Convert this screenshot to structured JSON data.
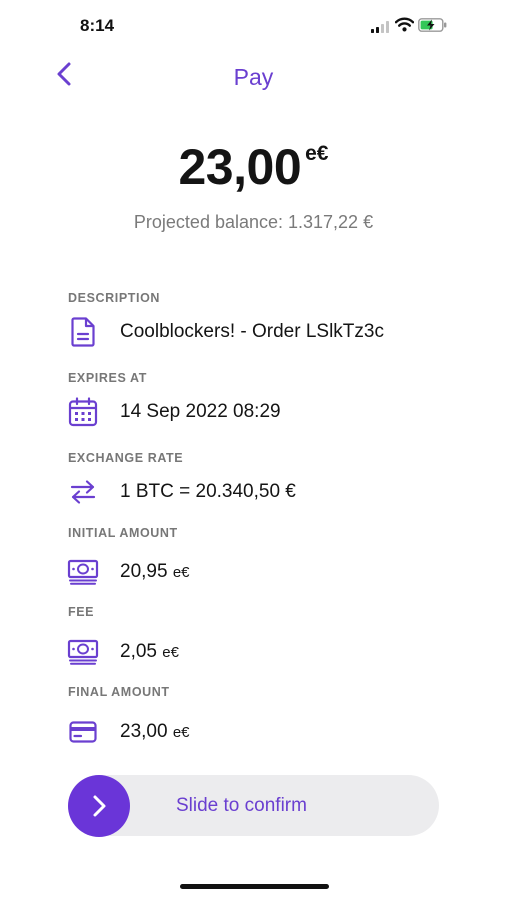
{
  "status_bar": {
    "time": "8:14",
    "icons": [
      "signal-icon",
      "wifi-icon",
      "battery-charging-icon"
    ]
  },
  "header": {
    "title": "Pay",
    "back_icon": "chevron-left-icon"
  },
  "amount": {
    "value": "23,00",
    "unit": "e€",
    "projected_balance": "Projected balance: 1.317,22 €"
  },
  "details": {
    "description": {
      "label": "DESCRIPTION",
      "value": "Coolblockers! - Order LSlkTz3c",
      "icon": "document-icon"
    },
    "expires_at": {
      "label": "EXPIRES AT",
      "value": "14 Sep 2022 08:29",
      "icon": "calendar-icon"
    },
    "exchange_rate": {
      "label": "EXCHANGE RATE",
      "value": "1 BTC = 20.340,50 €",
      "icon": "swap-arrows-icon"
    },
    "initial_amount": {
      "label": "INITIAL AMOUNT",
      "value": "20,95",
      "unit": "e€",
      "icon": "banknote-icon"
    },
    "fee": {
      "label": "FEE",
      "value": "2,05",
      "unit": "e€",
      "icon": "banknote-icon"
    },
    "final_amount": {
      "label": "FINAL AMOUNT",
      "value": "23,00",
      "unit": "e€",
      "icon": "card-icon"
    }
  },
  "slider": {
    "label": "Slide to confirm",
    "handle_icon": "chevron-right-icon"
  },
  "colors": {
    "accent": "#6a35d8",
    "text": "#141414",
    "muted": "#7a7a7a",
    "track": "#ececee"
  }
}
